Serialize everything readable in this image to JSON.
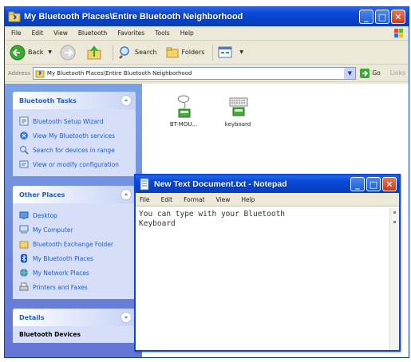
{
  "explorer": {
    "title": "My Bluetooth Places\\Entire Bluetooth Neighborhood",
    "menu": [
      "File",
      "Edit",
      "View",
      "Bluetooth",
      "Favorites",
      "Tools",
      "Help"
    ],
    "toolbar": {
      "back": "Back",
      "search": "Search",
      "folders": "Folders"
    },
    "address": {
      "label": "Address",
      "value": "My Bluetooth Places\\Entire Bluetooth Neighborhood",
      "go": "Go",
      "links": "Links"
    },
    "tasks": {
      "title": "Bluetooth Tasks",
      "items": [
        "Bluetooth Setup Wizard",
        "View My Bluetooth services",
        "Search for devices in range",
        "View or modify configuration"
      ]
    },
    "other_places": {
      "title": "Other Places",
      "items": [
        "Desktop",
        "My Computer",
        "Bluetooth Exchange Folder",
        "My Bluetooth Places",
        "My Network Places",
        "Printers and Faxes"
      ]
    },
    "details": {
      "title": "Details",
      "subtitle": "Bluetooth Devices"
    },
    "files": [
      "BT-MOU...",
      "keyboard"
    ]
  },
  "notepad": {
    "title": "New Text Document.txt - Notepad",
    "menu": [
      "File",
      "Edit",
      "Format",
      "View",
      "Help"
    ],
    "text": "You can type with your Bluetooth\nKeyboard"
  }
}
